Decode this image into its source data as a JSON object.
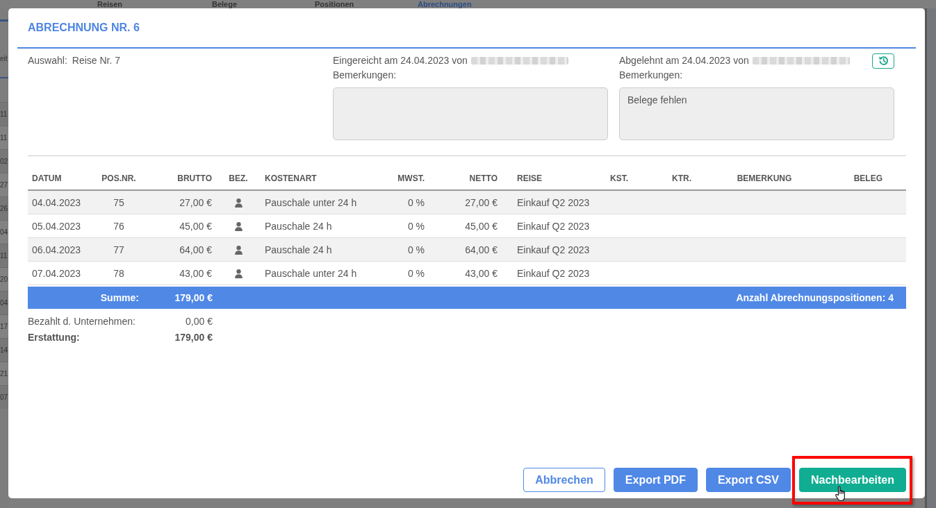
{
  "background": {
    "tabs": [
      {
        "label": "Reisen",
        "selected": false
      },
      {
        "label": "Belege",
        "selected": false
      },
      {
        "label": "Positionen",
        "selected": false
      },
      {
        "label": "Abrechnungen",
        "selected": true
      }
    ],
    "table": {
      "column_1": "eit",
      "rows": [
        "11",
        "11",
        "02",
        "27",
        "26",
        "04",
        "11",
        "20",
        "04",
        "17",
        "14",
        "21",
        "07"
      ]
    }
  },
  "dialog": {
    "title": "ABRECHNUNG NR. 6",
    "selection": {
      "label": "Auswahl:",
      "value": "Reise Nr. 7"
    },
    "submitted": {
      "text": "Eingereicht am 24.04.2023 von",
      "remarks_label": "Bemerkungen:"
    },
    "rejected": {
      "text": "Abgelehnt am 24.04.2023 von",
      "remarks_label": "Bemerkungen:",
      "remarks": "Belege fehlen"
    },
    "table": {
      "columns": [
        "DATUM",
        "POS.NR.",
        "BRUTTO",
        "BEZ.",
        "KOSTENART",
        "MWST.",
        "NETTO",
        "REISE",
        "KST.",
        "KTR.",
        "BEMERKUNG",
        "BELEG"
      ],
      "rows": [
        {
          "datum": "04.04.2023",
          "pos_nr": "75",
          "brutto": "27,00 €",
          "kostenart": "Pauschale unter 24 h",
          "mwst": "0 %",
          "netto": "27,00 €",
          "reise": "Einkauf Q2 2023"
        },
        {
          "datum": "05.04.2023",
          "pos_nr": "76",
          "brutto": "45,00 €",
          "kostenart": "Pauschale 24 h",
          "mwst": "0 %",
          "netto": "45,00 €",
          "reise": "Einkauf Q2 2023"
        },
        {
          "datum": "06.04.2023",
          "pos_nr": "77",
          "brutto": "64,00 €",
          "kostenart": "Pauschale 24 h",
          "mwst": "0 %",
          "netto": "64,00 €",
          "reise": "Einkauf Q2 2023"
        },
        {
          "datum": "07.04.2023",
          "pos_nr": "78",
          "brutto": "43,00 €",
          "kostenart": "Pauschale unter 24 h",
          "mwst": "0 %",
          "netto": "43,00 €",
          "reise": "Einkauf Q2 2023"
        }
      ]
    },
    "summary": {
      "label": "Summe:",
      "value": "179,00 €",
      "count": "Anzahl Abrechnungspositionen: 4"
    },
    "totals": [
      {
        "label": "Bezahlt d. Unternehmen:",
        "value": "0,00 €",
        "kind": "regular"
      },
      {
        "label": "Erstattung:",
        "value": "179,00 €",
        "kind": "total"
      }
    ],
    "buttons": [
      {
        "label": "Abbrechen",
        "kind": "outline",
        "highlighted": false,
        "hovered": false
      },
      {
        "label": "Export PDF",
        "kind": "primary",
        "highlighted": false,
        "hovered": false
      },
      {
        "label": "Export CSV",
        "kind": "primary",
        "highlighted": false,
        "hovered": false
      },
      {
        "label": "Nachbearbeiten",
        "kind": "success",
        "highlighted": true,
        "hovered": true
      }
    ]
  }
}
